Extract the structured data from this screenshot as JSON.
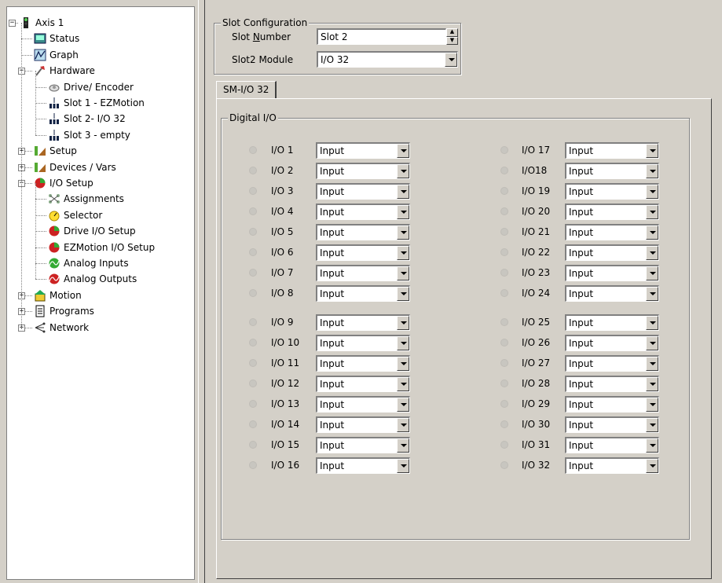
{
  "tree": {
    "items": [
      {
        "label": "Axis 1",
        "icon": "axis-icon",
        "level": 0,
        "expander": "minus"
      },
      {
        "label": "Status",
        "icon": "status-icon",
        "level": 1,
        "expander": ""
      },
      {
        "label": "Graph",
        "icon": "graph-icon",
        "level": 1,
        "expander": ""
      },
      {
        "label": "Hardware",
        "icon": "hardware-icon",
        "level": 1,
        "expander": "minus"
      },
      {
        "label": "Drive/ Encoder",
        "icon": "drive-encoder-icon",
        "level": 2,
        "expander": ""
      },
      {
        "label": "Slot 1 - EZMotion",
        "icon": "slot-icon",
        "level": 2,
        "expander": ""
      },
      {
        "label": "Slot 2- I/O 32",
        "icon": "slot-icon",
        "level": 2,
        "expander": ""
      },
      {
        "label": "Slot 3 - empty",
        "icon": "slot-icon",
        "level": 2,
        "expander": ""
      },
      {
        "label": "Setup",
        "icon": "setup-icon",
        "level": 1,
        "expander": "plus"
      },
      {
        "label": "Devices / Vars",
        "icon": "devices-icon",
        "level": 1,
        "expander": "plus"
      },
      {
        "label": "I/O Setup",
        "icon": "io-setup-icon",
        "level": 1,
        "expander": "minus"
      },
      {
        "label": "Assignments",
        "icon": "assignments-icon",
        "level": 2,
        "expander": ""
      },
      {
        "label": "Selector",
        "icon": "selector-icon",
        "level": 2,
        "expander": ""
      },
      {
        "label": "Drive I/O Setup",
        "icon": "io-setup-icon",
        "level": 2,
        "expander": ""
      },
      {
        "label": "EZMotion I/O Setup",
        "icon": "io-setup-icon",
        "level": 2,
        "expander": ""
      },
      {
        "label": "Analog Inputs",
        "icon": "analog-inputs-icon",
        "level": 2,
        "expander": ""
      },
      {
        "label": "Analog Outputs",
        "icon": "analog-outputs-icon",
        "level": 2,
        "expander": ""
      },
      {
        "label": "Motion",
        "icon": "motion-icon",
        "level": 1,
        "expander": "plus"
      },
      {
        "label": "Programs",
        "icon": "programs-icon",
        "level": 1,
        "expander": "plus"
      },
      {
        "label": "Network",
        "icon": "network-icon",
        "level": 1,
        "expander": "plus"
      }
    ]
  },
  "slot_config": {
    "title": "Slot Configuration",
    "slot_number_label_prefix": "Slot ",
    "slot_number_label_accel": "N",
    "slot_number_label_suffix": "umber",
    "slot_number_value": "Slot 2",
    "module_label": "Slot2 Module",
    "module_value": "I/O 32"
  },
  "tabs": [
    {
      "label": "SM-I/O 32"
    }
  ],
  "digital_io": {
    "title": "Digital I/O",
    "rows": [
      {
        "label": "I/O 1",
        "value": "Input"
      },
      {
        "label": "I/O 2",
        "value": "Input"
      },
      {
        "label": "I/O 3",
        "value": "Input"
      },
      {
        "label": "I/O 4",
        "value": "Input"
      },
      {
        "label": "I/O 5",
        "value": "Input"
      },
      {
        "label": "I/O 6",
        "value": "Input"
      },
      {
        "label": "I/O 7",
        "value": "Input"
      },
      {
        "label": "I/O 8",
        "value": "Input"
      },
      {
        "label": "I/O 9",
        "value": "Input"
      },
      {
        "label": "I/O 10",
        "value": "Input"
      },
      {
        "label": "I/O 11",
        "value": "Input"
      },
      {
        "label": "I/O 12",
        "value": "Input"
      },
      {
        "label": "I/O 13",
        "value": "Input"
      },
      {
        "label": "I/O 14",
        "value": "Input"
      },
      {
        "label": "I/O 15",
        "value": "Input"
      },
      {
        "label": "I/O 16",
        "value": "Input"
      },
      {
        "label": "I/O 17",
        "value": "Input"
      },
      {
        "label": "I/O18",
        "value": "Input"
      },
      {
        "label": "I/O 19",
        "value": "Input"
      },
      {
        "label": "I/O 20",
        "value": "Input"
      },
      {
        "label": "I/O 21",
        "value": "Input"
      },
      {
        "label": "I/O 22",
        "value": "Input"
      },
      {
        "label": "I/O 23",
        "value": "Input"
      },
      {
        "label": "I/O 24",
        "value": "Input"
      },
      {
        "label": "I/O 25",
        "value": "Input"
      },
      {
        "label": "I/O 26",
        "value": "Input"
      },
      {
        "label": "I/O 27",
        "value": "Input"
      },
      {
        "label": "I/O 28",
        "value": "Input"
      },
      {
        "label": "I/O 29",
        "value": "Input"
      },
      {
        "label": "I/O 30",
        "value": "Input"
      },
      {
        "label": "I/O 31",
        "value": "Input"
      },
      {
        "label": "I/O 32",
        "value": "Input"
      }
    ]
  },
  "colors": {
    "window_bg": "#d4d0c8",
    "tree_bg": "#ffffff",
    "led_off": "#c8c6c0"
  }
}
